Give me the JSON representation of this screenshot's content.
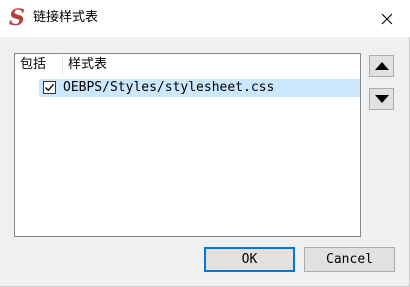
{
  "window": {
    "title": "链接样式表",
    "app_icon_glyph": "S",
    "accent_color": "#0078d7",
    "selection_color": "#cce8ff"
  },
  "list": {
    "columns": [
      "包括",
      "样式表"
    ],
    "rows": [
      {
        "checked": true,
        "path": "OEBPS/Styles/stylesheet.css"
      }
    ]
  },
  "side_buttons": {
    "up_icon": "triangle-up-icon",
    "down_icon": "triangle-down-icon"
  },
  "footer": {
    "ok_label": "OK",
    "cancel_label": "Cancel"
  }
}
